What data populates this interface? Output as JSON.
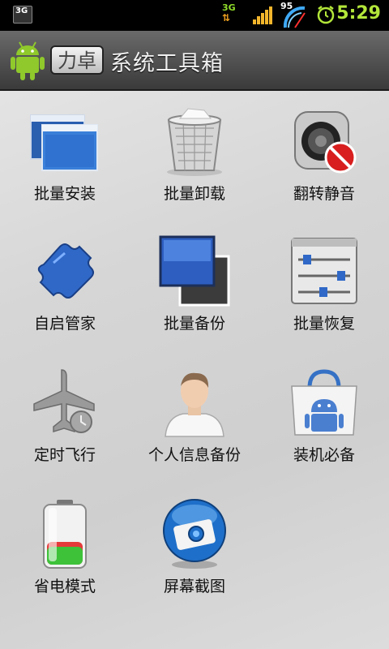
{
  "status_bar": {
    "network_left": "3G",
    "network_right": "3G",
    "battery_level": "95",
    "time": "5:29"
  },
  "header": {
    "brand": "力卓",
    "title": "系统工具箱"
  },
  "tools": [
    {
      "label": "批量安装",
      "icon": "app-windows-icon"
    },
    {
      "label": "批量卸载",
      "icon": "trash-bin-icon"
    },
    {
      "label": "翻转静音",
      "icon": "speaker-mute-icon"
    },
    {
      "label": "自启管家",
      "icon": "puzzle-piece-icon"
    },
    {
      "label": "批量备份",
      "icon": "stacked-windows-icon"
    },
    {
      "label": "批量恢复",
      "icon": "sliders-icon"
    },
    {
      "label": "定时飞行",
      "icon": "airplane-clock-icon"
    },
    {
      "label": "个人信息备份",
      "icon": "person-icon"
    },
    {
      "label": "装机必备",
      "icon": "market-bag-icon"
    },
    {
      "label": "省电模式",
      "icon": "battery-icon"
    },
    {
      "label": "屏幕截图",
      "icon": "camera-icon"
    }
  ]
}
